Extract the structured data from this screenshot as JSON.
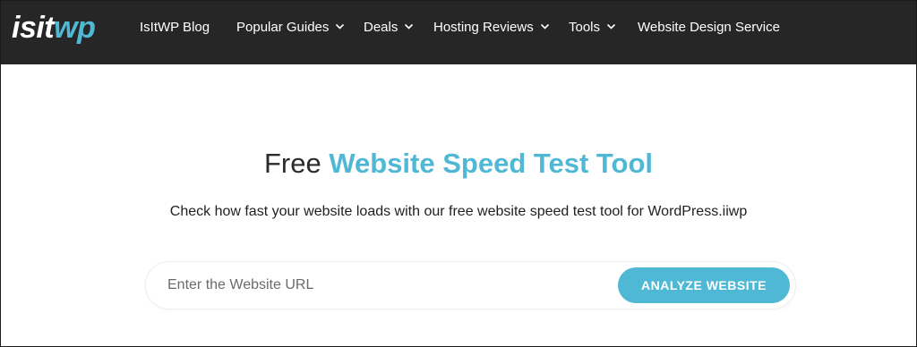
{
  "brand": {
    "logo_part1": "isit",
    "logo_part2": "wp",
    "accent_color": "#4fb8d4",
    "topbar_color": "#262626"
  },
  "nav": {
    "items": [
      {
        "label": "IsItWP Blog",
        "has_dropdown": false
      },
      {
        "label": "Popular Guides",
        "has_dropdown": true,
        "icon": "chevron-down-icon"
      },
      {
        "label": "Deals",
        "has_dropdown": true,
        "icon": "chevron-down-icon"
      },
      {
        "label": "Hosting Reviews",
        "has_dropdown": true,
        "icon": "chevron-down-icon"
      },
      {
        "label": "Tools",
        "has_dropdown": true,
        "icon": "chevron-down-icon"
      },
      {
        "label": "Website Design Service",
        "has_dropdown": false
      }
    ]
  },
  "hero": {
    "title_prefix": "Free ",
    "title_accent": "Website Speed Test Tool",
    "subtitle": "Check how fast your website loads with our free website speed test tool for WordPress.iiwp"
  },
  "search": {
    "placeholder": "Enter the Website URL",
    "value": "",
    "button_label": "ANALYZE WEBSITE"
  }
}
